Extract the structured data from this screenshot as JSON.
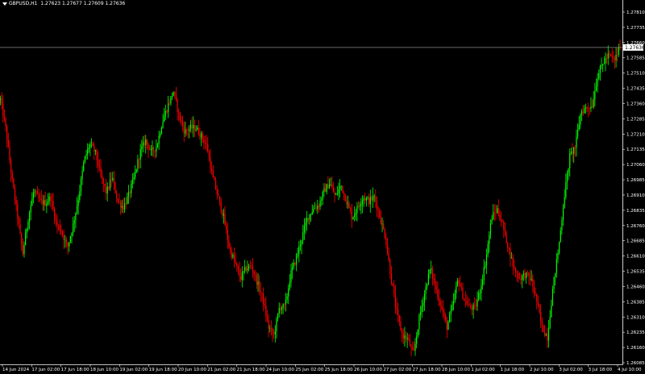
{
  "header": {
    "symbol": "GBPUSD,H1",
    "ohlc": "1.27623 1.27677 1.27609 1.27636"
  },
  "chart_data": {
    "type": "candlestick",
    "symbol": "GBPUSD",
    "timeframe": "H1",
    "current_price": 1.27636,
    "ylim": [
      1.26085,
      1.2781
    ],
    "y_ticks": [
      "1.27810",
      "1.27735",
      "1.27660",
      "1.27585",
      "1.27510",
      "1.27435",
      "1.27360",
      "1.27285",
      "1.27210",
      "1.27135",
      "1.27060",
      "1.26985",
      "1.26910",
      "1.26835",
      "1.26760",
      "1.26685",
      "1.26610",
      "1.26535",
      "1.26460",
      "1.26385",
      "1.26310",
      "1.26235",
      "1.26160",
      "1.26085"
    ],
    "x_ticks": [
      "14 Jun 2024",
      "17 Jun 02:00",
      "17 Jun 18:00",
      "18 Jun 10:00",
      "19 Jun 02:00",
      "19 Jun 18:00",
      "20 Jun 10:00",
      "21 Jun 02:00",
      "21 Jun 18:00",
      "24 Jun 10:00",
      "25 Jun 02:00",
      "25 Jun 18:00",
      "26 Jun 10:00",
      "27 Jun 02:00",
      "27 Jun 18:00",
      "28 Jun 10:00",
      "1 Jul 02:00",
      "1 Jul 18:00",
      "2 Jul 10:00",
      "3 Jul 02:00",
      "3 Jul 18:00",
      "4 Jul 10:00"
    ],
    "path": [
      1.2738,
      1.2723,
      1.27,
      1.2682,
      1.2662,
      1.268,
      1.2693,
      1.2688,
      1.2687,
      1.269,
      1.2677,
      1.2673,
      1.2665,
      1.2676,
      1.269,
      1.2708,
      1.2716,
      1.2712,
      1.27,
      1.2692,
      1.27,
      1.2688,
      1.2685,
      1.2691,
      1.27,
      1.2712,
      1.2718,
      1.2712,
      1.2715,
      1.2727,
      1.2735,
      1.2742,
      1.273,
      1.2722,
      1.2724,
      1.2724,
      1.272,
      1.2715,
      1.27,
      1.269,
      1.268,
      1.2665,
      1.2658,
      1.265,
      1.2655,
      1.2656,
      1.2648,
      1.264,
      1.2626,
      1.2622,
      1.2636,
      1.2636,
      1.2652,
      1.266,
      1.267,
      1.268,
      1.2684,
      1.2686,
      1.2693,
      1.2697,
      1.269,
      1.2696,
      1.2688,
      1.268,
      1.2685,
      1.269,
      1.2688,
      1.269,
      1.268,
      1.267,
      1.265,
      1.2633,
      1.2622,
      1.262,
      1.2612,
      1.263,
      1.2643,
      1.2655,
      1.2645,
      1.2636,
      1.2626,
      1.2636,
      1.265,
      1.264,
      1.2636,
      1.2635,
      1.2645,
      1.266,
      1.268,
      1.2684,
      1.2676,
      1.2665,
      1.2655,
      1.265,
      1.2652,
      1.265,
      1.264,
      1.2626,
      1.2621,
      1.2646,
      1.2665,
      1.269,
      1.271,
      1.2715,
      1.2732,
      1.2734,
      1.2735,
      1.275,
      1.2756,
      1.276,
      1.2757,
      1.2764
    ],
    "up_color": "#00FF00",
    "down_color": "#FF0000",
    "background": "#000000",
    "axis_color": "#FFFFFF",
    "grid": false
  }
}
